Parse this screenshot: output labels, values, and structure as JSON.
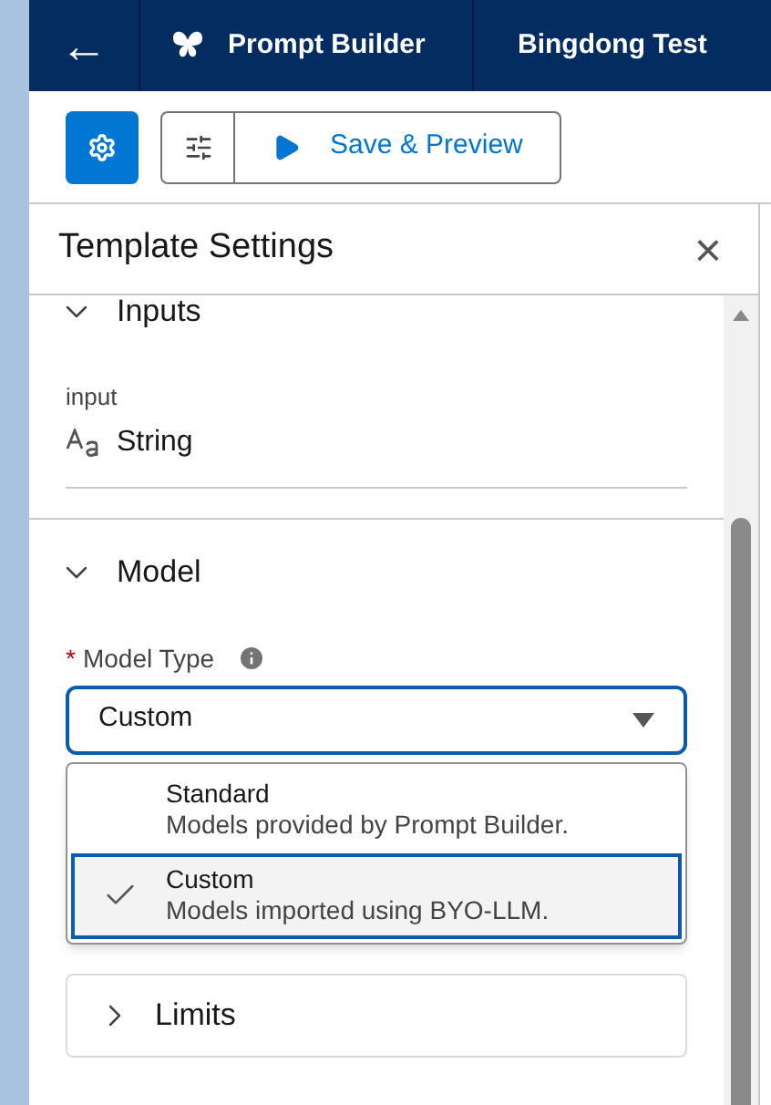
{
  "nav": {
    "back": "←",
    "app": "Prompt Builder",
    "tab": "Bingdong Test"
  },
  "toolbar": {
    "settings_selected": true,
    "save_preview": "Save & Preview"
  },
  "panel": {
    "title": "Template Settings",
    "close": "×"
  },
  "inputs": {
    "title": "Inputs",
    "expanded": true,
    "label": "input",
    "type": "String"
  },
  "model": {
    "title": "Model",
    "expanded": true,
    "field_label": "Model Type",
    "required_mark": "*",
    "value": "Custom",
    "options": [
      {
        "label": "Standard",
        "description": "Models provided by Prompt Builder.",
        "selected": false
      },
      {
        "label": "Custom",
        "description": "Models imported using BYO-LLM.",
        "selected": true
      }
    ]
  },
  "limits": {
    "title": "Limits",
    "expanded": false
  }
}
